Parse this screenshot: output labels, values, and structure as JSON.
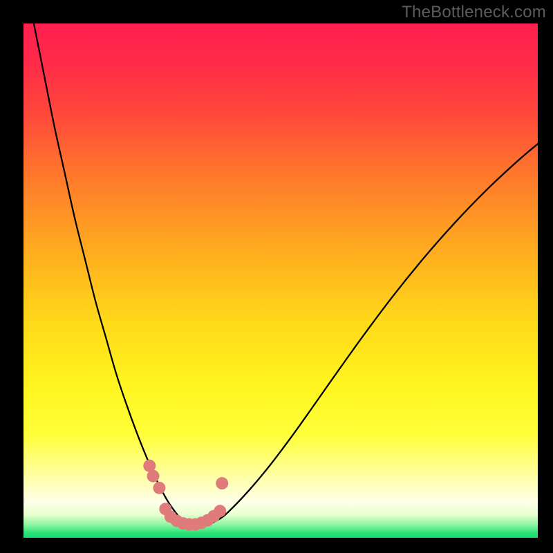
{
  "watermark": "TheBottleneck.com",
  "gradient": {
    "stops": [
      {
        "offset": 0.0,
        "color": "#ff1f4f"
      },
      {
        "offset": 0.08,
        "color": "#ff2b48"
      },
      {
        "offset": 0.18,
        "color": "#ff4a3a"
      },
      {
        "offset": 0.3,
        "color": "#ff7a2b"
      },
      {
        "offset": 0.45,
        "color": "#ffaf1f"
      },
      {
        "offset": 0.58,
        "color": "#ffd91a"
      },
      {
        "offset": 0.7,
        "color": "#fff41e"
      },
      {
        "offset": 0.8,
        "color": "#ffff3a"
      },
      {
        "offset": 0.86,
        "color": "#ffff8a"
      },
      {
        "offset": 0.9,
        "color": "#ffffc0"
      },
      {
        "offset": 0.93,
        "color": "#ffffe8"
      },
      {
        "offset": 0.955,
        "color": "#e8ffd0"
      },
      {
        "offset": 0.975,
        "color": "#8cf5a0"
      },
      {
        "offset": 0.99,
        "color": "#2de37a"
      },
      {
        "offset": 1.0,
        "color": "#16dd6e"
      }
    ]
  },
  "chart_data": {
    "type": "line",
    "title": "",
    "xlabel": "",
    "ylabel": "",
    "xlim": [
      0,
      100
    ],
    "ylim": [
      0,
      100
    ],
    "series": [
      {
        "name": "bottleneck-curve",
        "x": [
          0,
          2,
          4,
          6,
          8,
          10,
          12,
          14,
          16,
          18,
          20,
          22,
          24,
          26,
          27,
          28,
          29,
          30,
          31,
          32,
          33,
          34,
          36,
          38,
          40,
          44,
          48,
          52,
          56,
          60,
          66,
          72,
          78,
          84,
          90,
          96,
          100
        ],
        "y": [
          110,
          100,
          90,
          80,
          71,
          62,
          54,
          46,
          39,
          32,
          26,
          20.5,
          15.5,
          11,
          9,
          7.2,
          5.7,
          4.4,
          3.4,
          2.8,
          2.5,
          2.5,
          2.7,
          3.6,
          5.2,
          9.4,
          14.2,
          19.5,
          25.1,
          30.8,
          39.2,
          47.2,
          54.6,
          61.4,
          67.6,
          73.2,
          76.6
        ]
      }
    ],
    "markers": {
      "name": "highlight-points",
      "color": "#e07b7b",
      "radius_px": 9,
      "points": [
        {
          "x": 24.5,
          "y": 14.0
        },
        {
          "x": 25.2,
          "y": 12.0
        },
        {
          "x": 26.4,
          "y": 9.7
        },
        {
          "x": 27.6,
          "y": 5.6
        },
        {
          "x": 28.6,
          "y": 4.1
        },
        {
          "x": 29.8,
          "y": 3.3
        },
        {
          "x": 31.0,
          "y": 2.8
        },
        {
          "x": 32.2,
          "y": 2.6
        },
        {
          "x": 33.4,
          "y": 2.6
        },
        {
          "x": 34.6,
          "y": 2.9
        },
        {
          "x": 35.8,
          "y": 3.4
        },
        {
          "x": 37.0,
          "y": 4.2
        },
        {
          "x": 38.2,
          "y": 5.2
        },
        {
          "x": 38.6,
          "y": 10.6
        }
      ]
    }
  }
}
